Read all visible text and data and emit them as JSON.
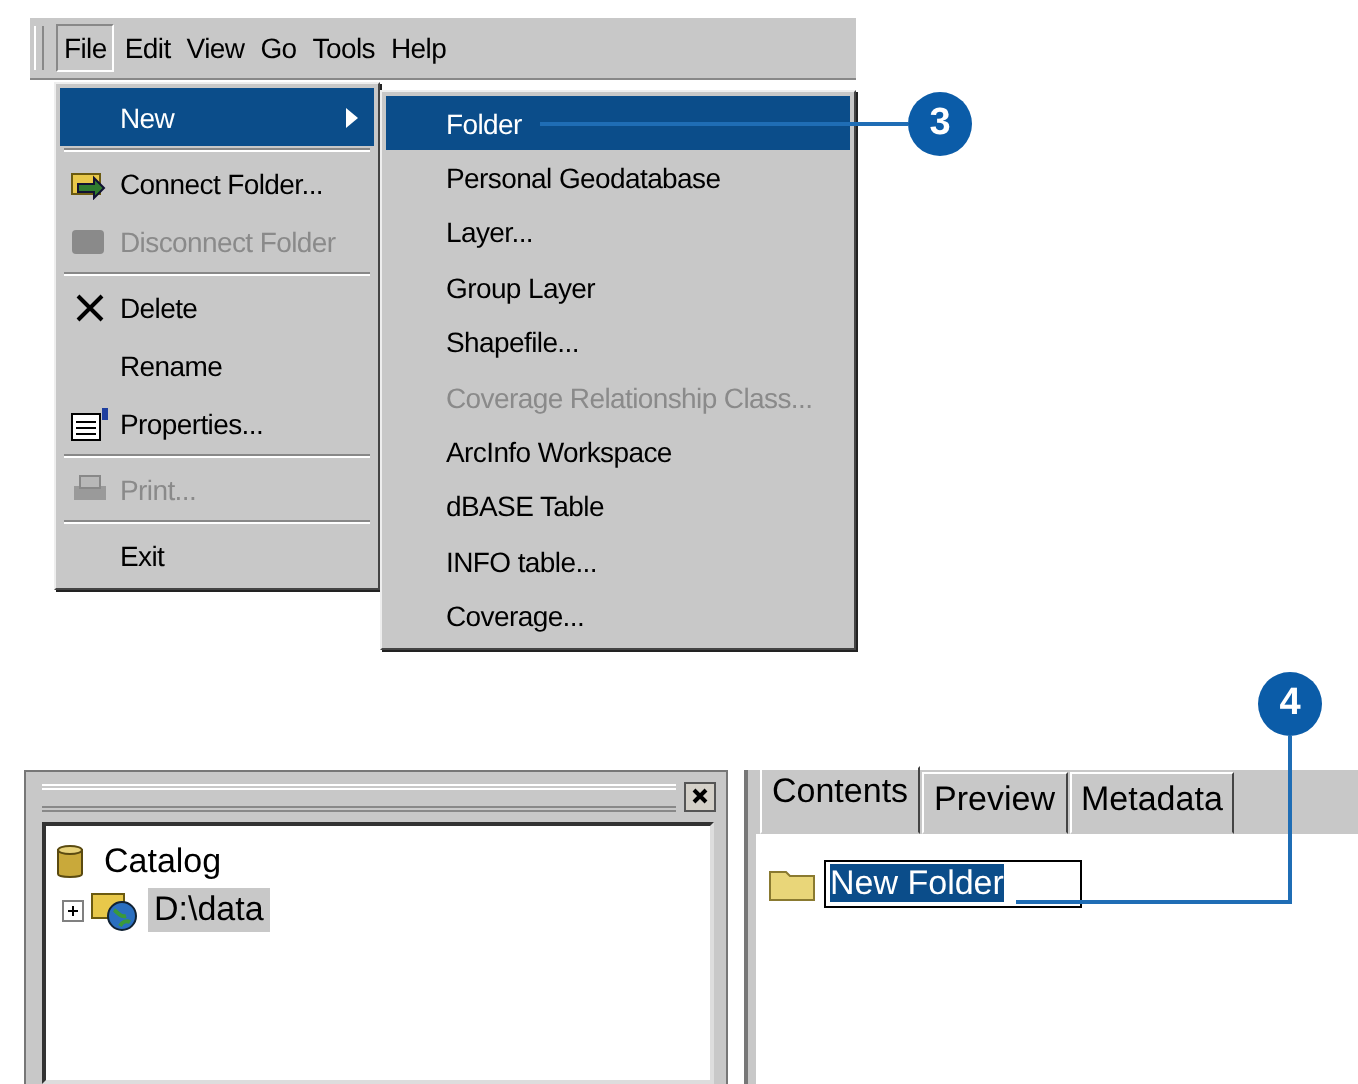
{
  "menu_bar": [
    {
      "label": "File",
      "selected": true
    },
    {
      "label": "Edit",
      "selected": false
    },
    {
      "label": "View",
      "selected": false
    },
    {
      "label": "Go",
      "selected": false
    },
    {
      "label": "Tools",
      "selected": false
    },
    {
      "label": "Help",
      "selected": false
    }
  ],
  "file_menu": [
    {
      "kind": "submenu",
      "label": "New",
      "selected": true,
      "disabled": false
    },
    {
      "kind": "separator"
    },
    {
      "kind": "item",
      "label": "Connect Folder...",
      "selected": false,
      "disabled": false
    },
    {
      "kind": "item",
      "label": "Disconnect Folder",
      "selected": false,
      "disabled": true
    },
    {
      "kind": "separator"
    },
    {
      "kind": "item",
      "label": "Delete",
      "selected": false,
      "disabled": false
    },
    {
      "kind": "item",
      "label": "Rename",
      "selected": false,
      "disabled": false
    },
    {
      "kind": "item",
      "label": "Properties...",
      "selected": false,
      "disabled": false
    },
    {
      "kind": "separator"
    },
    {
      "kind": "item",
      "label": "Print...",
      "selected": false,
      "disabled": true
    },
    {
      "kind": "separator"
    },
    {
      "kind": "item",
      "label": "Exit",
      "selected": false,
      "disabled": false
    }
  ],
  "new_submenu": [
    {
      "label": "Folder",
      "selected": true,
      "disabled": false
    },
    {
      "label": "Personal Geodatabase",
      "selected": false,
      "disabled": false
    },
    {
      "label": "Layer...",
      "selected": false,
      "disabled": false
    },
    {
      "label": "Group Layer",
      "selected": false,
      "disabled": false
    },
    {
      "label": "Shapefile...",
      "selected": false,
      "disabled": false
    },
    {
      "label": "Coverage Relationship Class...",
      "selected": false,
      "disabled": true
    },
    {
      "label": "ArcInfo Workspace",
      "selected": false,
      "disabled": false
    },
    {
      "label": "dBASE Table",
      "selected": false,
      "disabled": false
    },
    {
      "label": "INFO table...",
      "selected": false,
      "disabled": false
    },
    {
      "label": "Coverage...",
      "selected": false,
      "disabled": false
    }
  ],
  "callouts": [
    "3",
    "4"
  ],
  "catalog_tree": {
    "label": "Catalog",
    "children": [
      {
        "label": "D:\\data",
        "expanded": false,
        "selected": true
      }
    ]
  },
  "tabs": [
    {
      "label": "Contents",
      "selected": true
    },
    {
      "label": "Preview",
      "selected": false
    },
    {
      "label": "Metadata",
      "selected": false
    }
  ],
  "contents": [
    {
      "name": "New Folder",
      "editing": true
    }
  ]
}
